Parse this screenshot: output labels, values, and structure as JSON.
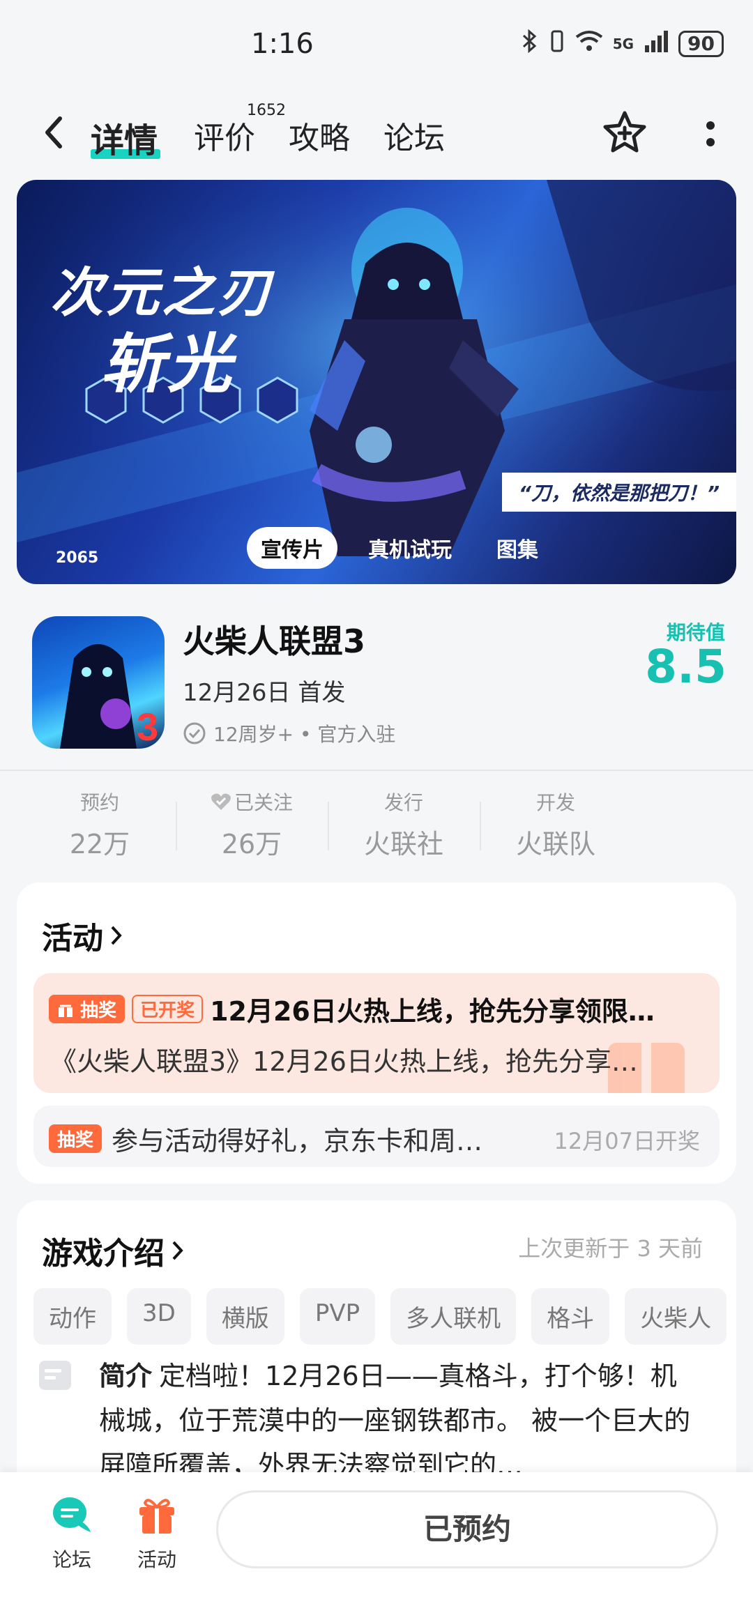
{
  "status_bar": {
    "time": "1:16",
    "battery": "90",
    "network": "5G"
  },
  "nav": {
    "tabs": [
      {
        "label": "详情"
      },
      {
        "label": "评价"
      },
      {
        "label": "攻略"
      },
      {
        "label": "论坛"
      }
    ],
    "review_count": "1652"
  },
  "banner": {
    "title_line1": "次元之刃",
    "title_line2": "斩光",
    "quote": "“刀，依然是那把刀！”",
    "year_mark": "2065",
    "media_tabs": [
      "宣传片",
      "真机试玩",
      "图集"
    ]
  },
  "game": {
    "name": "火柴人联盟3",
    "release": "12月26日 首发",
    "meta": "12周岁+ • 官方入驻",
    "expect_label": "期待值",
    "expect_score": "8.5"
  },
  "stats": [
    {
      "label": "预约",
      "value": "22万"
    },
    {
      "label": "已关注",
      "value": "26万"
    },
    {
      "label": "发行",
      "value": "火联社"
    },
    {
      "label": "开发",
      "value": "火联队"
    }
  ],
  "activity": {
    "title": "活动",
    "main": {
      "badge": "抽奖",
      "status": "已开奖",
      "title": "12月26日火热上线，抢先分享领限…",
      "desc": "《火柴人联盟3》12月26日火热上线，抢先分享…"
    },
    "sub": {
      "badge": "抽奖",
      "text": "参与活动得好礼，京东卡和周…",
      "date": "12月07日开奖"
    }
  },
  "intro": {
    "title": "游戏介绍",
    "updated": "上次更新于 3 天前",
    "tags": [
      "动作",
      "3D",
      "横版",
      "PVP",
      "多人联机",
      "格斗",
      "火柴人"
    ],
    "label": "简介",
    "text": "定档啦！12月26日——真格斗，打个够！机械城，位于荒漠中的一座钢铁都市。 被一个巨大的屏障所覆盖，外界无法察觉到它的…"
  },
  "bottom": {
    "forum_label": "论坛",
    "activity_label": "活动",
    "reserved_label": "已预约"
  },
  "colors": {
    "accent": "#17c0b0",
    "tab_underline": "#17d4c2",
    "lottery": "#ff6a3d",
    "activity_bg": "#fde8e1"
  }
}
